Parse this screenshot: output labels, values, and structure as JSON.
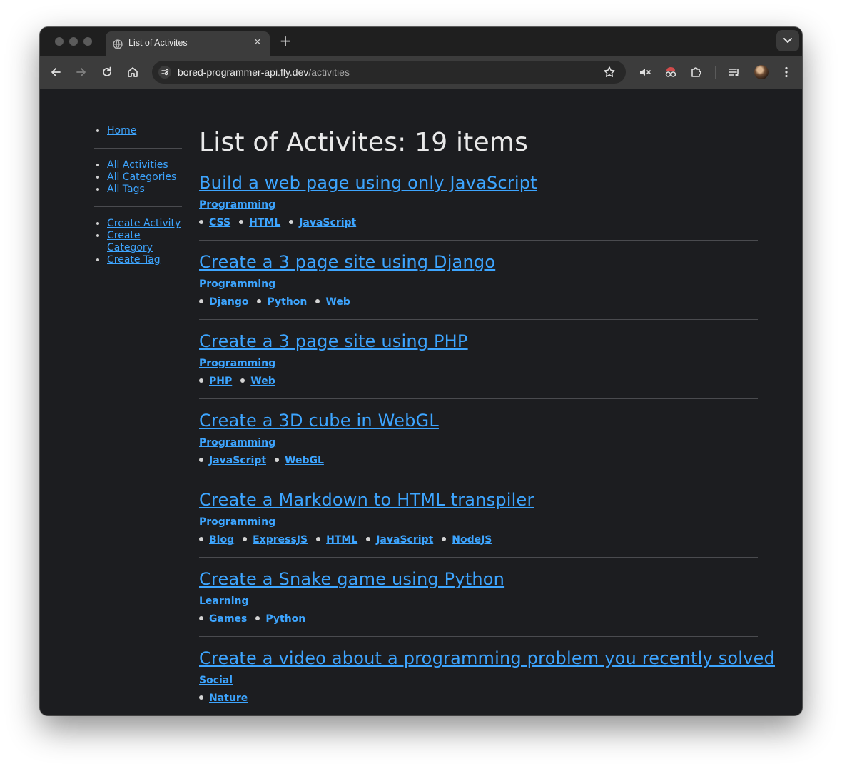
{
  "browser": {
    "tab_title": "List of Activites",
    "url_host": "bored-programmer-api.fly.dev",
    "url_path": "/activities",
    "new_tab_label": "+",
    "close_label": "✕"
  },
  "nav": {
    "group1": [
      {
        "label": "Home"
      }
    ],
    "group2": [
      {
        "label": "All Activities"
      },
      {
        "label": "All Categories"
      },
      {
        "label": "All Tags"
      }
    ],
    "group3": [
      {
        "label": "Create Activity"
      },
      {
        "label": "Create Category"
      },
      {
        "label": "Create Tag"
      }
    ]
  },
  "page": {
    "title": "List of Activites: 19 items"
  },
  "activities": [
    {
      "title": "Build a web page using only JavaScript",
      "category": "Programming",
      "tags": [
        "CSS",
        "HTML",
        "JavaScript"
      ]
    },
    {
      "title": "Create a 3 page site using Django",
      "category": "Programming",
      "tags": [
        "Django",
        "Python",
        "Web"
      ]
    },
    {
      "title": "Create a 3 page site using PHP",
      "category": "Programming",
      "tags": [
        "PHP",
        "Web"
      ]
    },
    {
      "title": "Create a 3D cube in WebGL",
      "category": "Programming",
      "tags": [
        "JavaScript",
        "WebGL"
      ]
    },
    {
      "title": "Create a Markdown to HTML transpiler",
      "category": "Programming",
      "tags": [
        "Blog",
        "ExpressJS",
        "HTML",
        "JavaScript",
        "NodeJS"
      ]
    },
    {
      "title": "Create a Snake game using Python",
      "category": "Learning",
      "tags": [
        "Games",
        "Python"
      ]
    },
    {
      "title": "Create a video about a programming problem you recently solved",
      "category": "Social",
      "tags": [
        "Nature"
      ]
    }
  ],
  "colors": {
    "link": "#3da5ff",
    "page_bg": "#1c1d20",
    "toolbar": "#3c3c3c"
  }
}
